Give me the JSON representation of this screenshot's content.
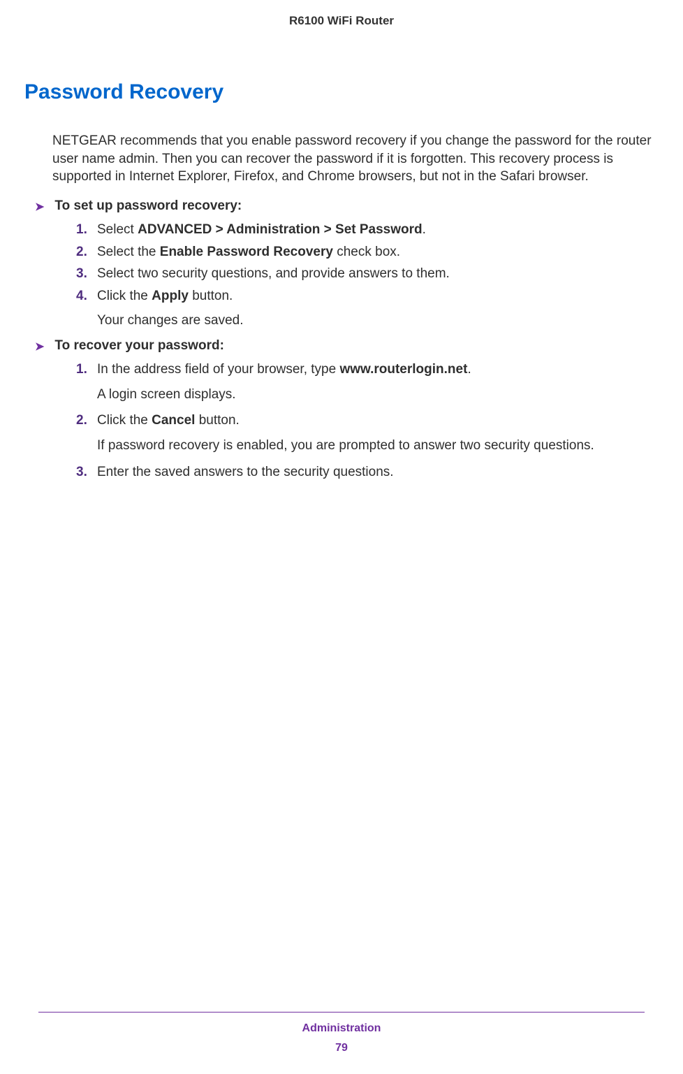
{
  "header": {
    "title": "R6100 WiFi Router"
  },
  "section": {
    "title": "Password Recovery",
    "intro": "NETGEAR recommends that you enable password recovery if you change the password for the router user name admin. Then you can recover the password if it is forgotten. This recovery process is supported in Internet Explorer, Firefox, and Chrome browsers, but not in the Safari browser."
  },
  "proc1": {
    "heading": "To set up password recovery:",
    "step1": {
      "num": "1.",
      "pre": "Select ",
      "bold": "ADVANCED > Administration > Set Password",
      "post": "."
    },
    "step2": {
      "num": "2.",
      "pre": "Select the ",
      "bold": "Enable Password Recovery",
      "post": " check box."
    },
    "step3": {
      "num": "3.",
      "text": "Select two security questions, and provide answers to them."
    },
    "step4": {
      "num": "4.",
      "pre": "Click the ",
      "bold": "Apply",
      "post": " button.",
      "sub": "Your changes are saved."
    }
  },
  "proc2": {
    "heading": "To recover your password:",
    "step1": {
      "num": "1.",
      "pre": "In the address field of your browser, type ",
      "bold": "www.routerlogin.net",
      "post": ".",
      "sub": "A login screen displays."
    },
    "step2": {
      "num": "2.",
      "pre": "Click the ",
      "bold": "Cancel",
      "post": " button.",
      "sub": "If password recovery is enabled, you are prompted to answer two security questions."
    },
    "step3": {
      "num": "3.",
      "text": "Enter the saved answers to the security questions."
    }
  },
  "footer": {
    "chapter": "Administration",
    "page": "79"
  },
  "arrow": "➤"
}
